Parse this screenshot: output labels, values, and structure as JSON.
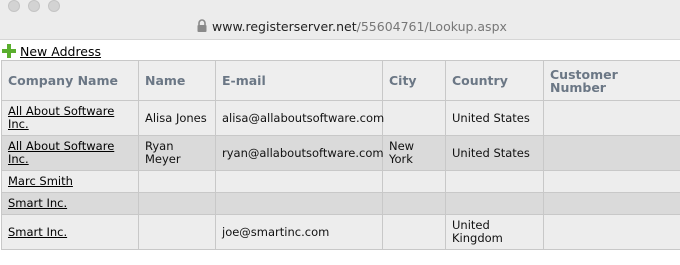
{
  "browser": {
    "url_host": "www.registerserver.net",
    "url_path": "/55604761/Lookup.aspx"
  },
  "toolbar": {
    "new_address_label": "New Address",
    "new_address_icon": "plus-icon",
    "icon_color": "#5aae2e"
  },
  "table": {
    "headers": {
      "company": "Company Name",
      "name": "Name",
      "email": "E-mail",
      "city": "City",
      "country": "Country",
      "customer_number": "Customer Number"
    },
    "rows": [
      {
        "company": "All About Software Inc.",
        "name": "Alisa Jones",
        "email": "alisa@allaboutsoftware.com",
        "city": "",
        "country": "United States",
        "customer_number": ""
      },
      {
        "company": "All About Software Inc.",
        "name": "Ryan Meyer",
        "email": "ryan@allaboutsoftware.com",
        "city": "New York",
        "country": "United States",
        "customer_number": ""
      },
      {
        "company": "Marc Smith",
        "name": "",
        "email": "",
        "city": "",
        "country": "",
        "customer_number": ""
      },
      {
        "company": "Smart Inc.",
        "name": "",
        "email": "",
        "city": "",
        "country": "",
        "customer_number": ""
      },
      {
        "company": "Smart Inc.",
        "name": "",
        "email": "joe@smartinc.com",
        "city": "",
        "country": "United Kingdom",
        "customer_number": ""
      }
    ]
  }
}
